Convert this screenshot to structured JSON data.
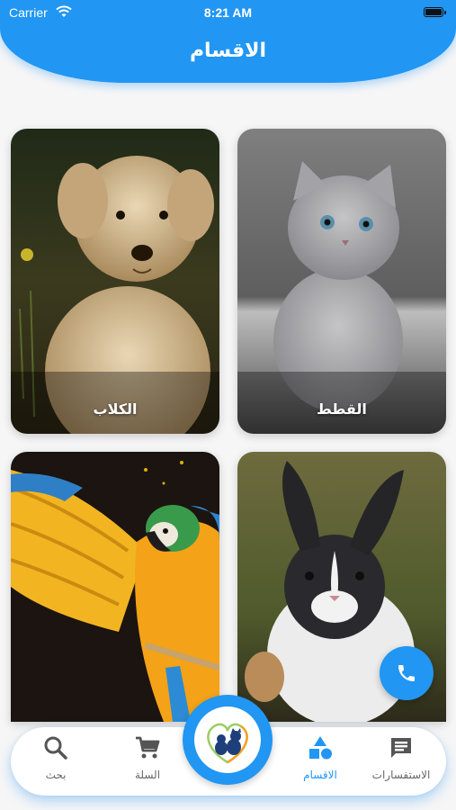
{
  "status_bar": {
    "carrier": "Carrier",
    "time": "8:21 AM"
  },
  "header": {
    "title": "الاقسام"
  },
  "categories": [
    {
      "label": "الكلاب"
    },
    {
      "label": "القطط"
    },
    {
      "label": "",
      "image": "parrot"
    },
    {
      "label": "",
      "image": "rabbit"
    }
  ],
  "bottom_nav": {
    "items": [
      {
        "label": "بحث",
        "icon": "search-icon"
      },
      {
        "label": "السلة",
        "icon": "cart-icon"
      },
      {
        "label": "الاقسام",
        "icon": "shapes-icon",
        "active": true
      },
      {
        "label": "الاستفسارات",
        "icon": "chat-icon"
      }
    ]
  },
  "colors": {
    "primary": "#2196f3",
    "background": "#f6f6f7",
    "inactive": "#666666"
  }
}
